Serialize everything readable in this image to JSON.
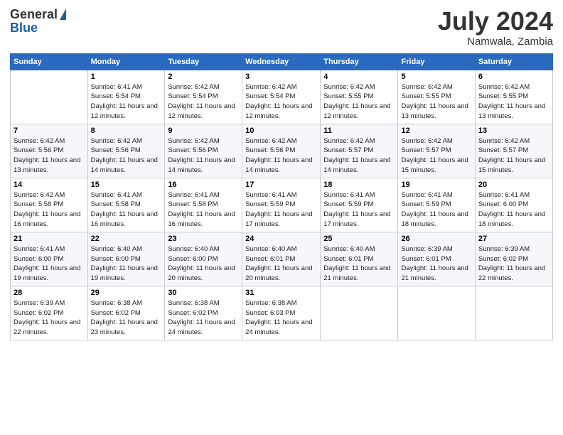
{
  "logo": {
    "line1": "General",
    "line2": "Blue"
  },
  "header": {
    "month": "July 2024",
    "location": "Namwala, Zambia"
  },
  "weekdays": [
    "Sunday",
    "Monday",
    "Tuesday",
    "Wednesday",
    "Thursday",
    "Friday",
    "Saturday"
  ],
  "weeks": [
    [
      {
        "day": "",
        "sunrise": "",
        "sunset": "",
        "daylight": ""
      },
      {
        "day": "1",
        "sunrise": "Sunrise: 6:41 AM",
        "sunset": "Sunset: 5:54 PM",
        "daylight": "Daylight: 11 hours and 12 minutes."
      },
      {
        "day": "2",
        "sunrise": "Sunrise: 6:42 AM",
        "sunset": "Sunset: 5:54 PM",
        "daylight": "Daylight: 11 hours and 12 minutes."
      },
      {
        "day": "3",
        "sunrise": "Sunrise: 6:42 AM",
        "sunset": "Sunset: 5:54 PM",
        "daylight": "Daylight: 11 hours and 12 minutes."
      },
      {
        "day": "4",
        "sunrise": "Sunrise: 6:42 AM",
        "sunset": "Sunset: 5:55 PM",
        "daylight": "Daylight: 11 hours and 12 minutes."
      },
      {
        "day": "5",
        "sunrise": "Sunrise: 6:42 AM",
        "sunset": "Sunset: 5:55 PM",
        "daylight": "Daylight: 11 hours and 13 minutes."
      },
      {
        "day": "6",
        "sunrise": "Sunrise: 6:42 AM",
        "sunset": "Sunset: 5:55 PM",
        "daylight": "Daylight: 11 hours and 13 minutes."
      }
    ],
    [
      {
        "day": "7",
        "sunrise": "Sunrise: 6:42 AM",
        "sunset": "Sunset: 5:56 PM",
        "daylight": "Daylight: 11 hours and 13 minutes."
      },
      {
        "day": "8",
        "sunrise": "Sunrise: 6:42 AM",
        "sunset": "Sunset: 5:56 PM",
        "daylight": "Daylight: 11 hours and 14 minutes."
      },
      {
        "day": "9",
        "sunrise": "Sunrise: 6:42 AM",
        "sunset": "Sunset: 5:56 PM",
        "daylight": "Daylight: 11 hours and 14 minutes."
      },
      {
        "day": "10",
        "sunrise": "Sunrise: 6:42 AM",
        "sunset": "Sunset: 5:56 PM",
        "daylight": "Daylight: 11 hours and 14 minutes."
      },
      {
        "day": "11",
        "sunrise": "Sunrise: 6:42 AM",
        "sunset": "Sunset: 5:57 PM",
        "daylight": "Daylight: 11 hours and 14 minutes."
      },
      {
        "day": "12",
        "sunrise": "Sunrise: 6:42 AM",
        "sunset": "Sunset: 5:57 PM",
        "daylight": "Daylight: 11 hours and 15 minutes."
      },
      {
        "day": "13",
        "sunrise": "Sunrise: 6:42 AM",
        "sunset": "Sunset: 5:57 PM",
        "daylight": "Daylight: 11 hours and 15 minutes."
      }
    ],
    [
      {
        "day": "14",
        "sunrise": "Sunrise: 6:42 AM",
        "sunset": "Sunset: 5:58 PM",
        "daylight": "Daylight: 11 hours and 16 minutes."
      },
      {
        "day": "15",
        "sunrise": "Sunrise: 6:41 AM",
        "sunset": "Sunset: 5:58 PM",
        "daylight": "Daylight: 11 hours and 16 minutes."
      },
      {
        "day": "16",
        "sunrise": "Sunrise: 6:41 AM",
        "sunset": "Sunset: 5:58 PM",
        "daylight": "Daylight: 11 hours and 16 minutes."
      },
      {
        "day": "17",
        "sunrise": "Sunrise: 6:41 AM",
        "sunset": "Sunset: 5:59 PM",
        "daylight": "Daylight: 11 hours and 17 minutes."
      },
      {
        "day": "18",
        "sunrise": "Sunrise: 6:41 AM",
        "sunset": "Sunset: 5:59 PM",
        "daylight": "Daylight: 11 hours and 17 minutes."
      },
      {
        "day": "19",
        "sunrise": "Sunrise: 6:41 AM",
        "sunset": "Sunset: 5:59 PM",
        "daylight": "Daylight: 11 hours and 18 minutes."
      },
      {
        "day": "20",
        "sunrise": "Sunrise: 6:41 AM",
        "sunset": "Sunset: 6:00 PM",
        "daylight": "Daylight: 11 hours and 18 minutes."
      }
    ],
    [
      {
        "day": "21",
        "sunrise": "Sunrise: 6:41 AM",
        "sunset": "Sunset: 6:00 PM",
        "daylight": "Daylight: 11 hours and 19 minutes."
      },
      {
        "day": "22",
        "sunrise": "Sunrise: 6:40 AM",
        "sunset": "Sunset: 6:00 PM",
        "daylight": "Daylight: 11 hours and 19 minutes."
      },
      {
        "day": "23",
        "sunrise": "Sunrise: 6:40 AM",
        "sunset": "Sunset: 6:00 PM",
        "daylight": "Daylight: 11 hours and 20 minutes."
      },
      {
        "day": "24",
        "sunrise": "Sunrise: 6:40 AM",
        "sunset": "Sunset: 6:01 PM",
        "daylight": "Daylight: 11 hours and 20 minutes."
      },
      {
        "day": "25",
        "sunrise": "Sunrise: 6:40 AM",
        "sunset": "Sunset: 6:01 PM",
        "daylight": "Daylight: 11 hours and 21 minutes."
      },
      {
        "day": "26",
        "sunrise": "Sunrise: 6:39 AM",
        "sunset": "Sunset: 6:01 PM",
        "daylight": "Daylight: 11 hours and 21 minutes."
      },
      {
        "day": "27",
        "sunrise": "Sunrise: 6:39 AM",
        "sunset": "Sunset: 6:02 PM",
        "daylight": "Daylight: 11 hours and 22 minutes."
      }
    ],
    [
      {
        "day": "28",
        "sunrise": "Sunrise: 6:39 AM",
        "sunset": "Sunset: 6:02 PM",
        "daylight": "Daylight: 11 hours and 22 minutes."
      },
      {
        "day": "29",
        "sunrise": "Sunrise: 6:38 AM",
        "sunset": "Sunset: 6:02 PM",
        "daylight": "Daylight: 11 hours and 23 minutes."
      },
      {
        "day": "30",
        "sunrise": "Sunrise: 6:38 AM",
        "sunset": "Sunset: 6:02 PM",
        "daylight": "Daylight: 11 hours and 24 minutes."
      },
      {
        "day": "31",
        "sunrise": "Sunrise: 6:38 AM",
        "sunset": "Sunset: 6:03 PM",
        "daylight": "Daylight: 11 hours and 24 minutes."
      },
      {
        "day": "",
        "sunrise": "",
        "sunset": "",
        "daylight": ""
      },
      {
        "day": "",
        "sunrise": "",
        "sunset": "",
        "daylight": ""
      },
      {
        "day": "",
        "sunrise": "",
        "sunset": "",
        "daylight": ""
      }
    ]
  ]
}
